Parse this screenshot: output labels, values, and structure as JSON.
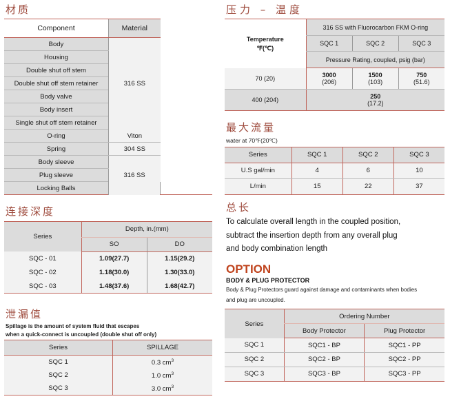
{
  "sections": {
    "material": {
      "title": "材质",
      "columns": [
        "Component",
        "Material"
      ],
      "rows": [
        {
          "component": "Body",
          "material": "316 SS",
          "group": 1
        },
        {
          "component": "Housing",
          "material": "",
          "group": 1
        },
        {
          "component": "Double shut off stem",
          "material": "",
          "group": 1
        },
        {
          "component": "Double shut off stem retainer",
          "material": "",
          "group": 1
        },
        {
          "component": "Body valve",
          "material": "",
          "group": 1
        },
        {
          "component": "Body insert",
          "material": "",
          "group": 1
        },
        {
          "component": "Single shut off stem retainer",
          "material": "",
          "group": 1
        },
        {
          "component": "O-ring",
          "material": "Viton",
          "group": 2
        },
        {
          "component": "Spring",
          "material": "304 SS",
          "group": 3
        },
        {
          "component": "Body sleeve",
          "material": "316 SS",
          "group": 4
        },
        {
          "component": "Plug sleeve",
          "material": "",
          "group": 4
        },
        {
          "component": "Locking Balls",
          "material": "",
          "group": 4
        }
      ],
      "merged": {
        "g1": "316 SS",
        "g2": "Viton",
        "g3": "304 SS",
        "g4": "316 SS"
      }
    },
    "depth": {
      "title": "连接深度",
      "col_series": "Series",
      "col_depth": "Depth, in.(mm)",
      "sub_cols": [
        "SO",
        "DO"
      ],
      "rows": [
        {
          "series": "SQC - 01",
          "so": "1.09(27.7)",
          "do": "1.15(29.2)"
        },
        {
          "series": "SQC - 02",
          "so": "1.18(30.0)",
          "do": "1.30(33.0)"
        },
        {
          "series": "SQC - 03",
          "so": "1.48(37.6)",
          "do": "1.68(42.7)"
        }
      ]
    },
    "spillage": {
      "title": "泄漏值",
      "note_line1": "Spillage is the amount of system fluid that escapes",
      "note_line2": "when a quick-connect is uncoupled (double shut off only)",
      "columns": [
        "Series",
        "SPILLAGE"
      ],
      "rows": [
        {
          "series": "SQC 1",
          "value": "0.3 cm",
          "unit_sup": "3"
        },
        {
          "series": "SQC 2",
          "value": "1.0 cm",
          "unit_sup": "3"
        },
        {
          "series": "SQC 3",
          "value": "3.0 cm",
          "unit_sup": "3"
        }
      ]
    },
    "pressure": {
      "title": "压力 – 温度",
      "temp_label_line1": "Temperature",
      "temp_label_line2": "℉(℃)",
      "material_header": "316 SS with Fluorocarbon FKM O-ring",
      "series": [
        "SQC 1",
        "SQC 2",
        "SQC 3"
      ],
      "rating_header": "Pressure Rating, coupled, psig (bar)",
      "rows": [
        {
          "temp": "70 (20)",
          "cells": [
            {
              "psig": "3000",
              "bar": "(206)"
            },
            {
              "psig": "1500",
              "bar": "(103)"
            },
            {
              "psig": "750",
              "bar": "(51.6)"
            }
          ]
        },
        {
          "temp": "400 (204)",
          "merged": {
            "psig": "250",
            "bar": "(17.2)"
          }
        }
      ]
    },
    "flow": {
      "title": "最大流量",
      "note": "water at 70℉(20℃)",
      "header": [
        "Series",
        "SQC 1",
        "SQC 2",
        "SQC 3"
      ],
      "rows": [
        {
          "label": "U.S gal/min",
          "values": [
            "4",
            "6",
            "10"
          ]
        },
        {
          "label": "L/min",
          "values": [
            "15",
            "22",
            "37"
          ]
        }
      ]
    },
    "overall_length": {
      "title": "总长",
      "line1": "To calculate overall length in the coupled position,",
      "line2": "subtract the insertion depth from any overall plug",
      "line3": "and body combination length"
    },
    "option": {
      "title": "OPTION",
      "subtitle": "BODY & PLUG PROTECTOR",
      "desc_line1": "Body & Plug Protectors guard against damage and contaminants when  bodies",
      "desc_line2": "and plug are uncoupled.",
      "col_series": "Series",
      "col_ordering": "Ordering Number",
      "sub_cols": [
        "Body Protector",
        "Plug Protector"
      ],
      "rows": [
        {
          "series": "SQC 1",
          "body": "SQC1 - BP",
          "plug": "SQC1 - PP"
        },
        {
          "series": "SQC 2",
          "body": "SQC2 - BP",
          "plug": "SQC2 - PP"
        },
        {
          "series": "SQC 3",
          "body": "SQC3 - BP",
          "plug": "SQC3 - PP"
        }
      ]
    }
  },
  "colors": {
    "accent_rule": "#c0645a",
    "title_text": "#9e4a3c",
    "option_title": "#c0441e",
    "header_gray": "#dcdcdc",
    "cell_light": "#f2f2f2"
  }
}
